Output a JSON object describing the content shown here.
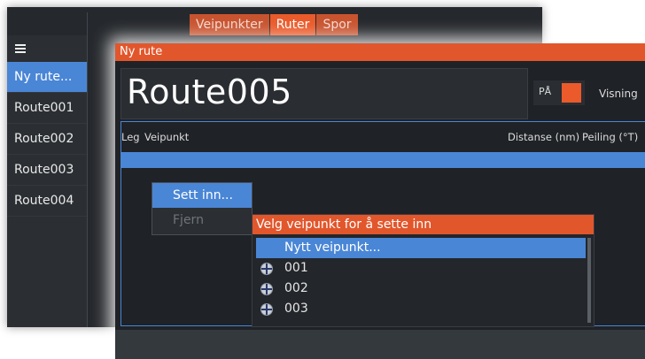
{
  "tabs": [
    {
      "label": "Veipunkter",
      "active": false
    },
    {
      "label": "Ruter",
      "active": true
    },
    {
      "label": "Spor",
      "active": false
    }
  ],
  "sidebar": {
    "items": [
      {
        "label": "Ny rute...",
        "active": true
      },
      {
        "label": "Route001"
      },
      {
        "label": "Route002"
      },
      {
        "label": "Route003"
      },
      {
        "label": "Route004"
      }
    ]
  },
  "dialog": {
    "title": "Ny rute",
    "route_name": "Route005",
    "toggle_label": "PÅ",
    "display_label": "Visning",
    "columns": {
      "leg": "Leg",
      "waypoint": "Veipunkt",
      "distance": "Distanse (nm)",
      "bearing": "Peiling (°T)"
    }
  },
  "context_menu": {
    "items": [
      {
        "label": "Sett inn...",
        "active": true
      },
      {
        "label": "Fjern",
        "disabled": true
      }
    ]
  },
  "picker": {
    "title": "Velg veipunkt for å sette inn",
    "items": [
      {
        "label": "Nytt veipunkt...",
        "active": true
      },
      {
        "label": "001",
        "icon": "waypoint-icon"
      },
      {
        "label": "002",
        "icon": "waypoint-icon"
      },
      {
        "label": "003",
        "icon": "waypoint-icon"
      }
    ]
  },
  "colors": {
    "accent": "#ea5a2a",
    "selection": "#4a86d6",
    "background": "#1f2226"
  }
}
